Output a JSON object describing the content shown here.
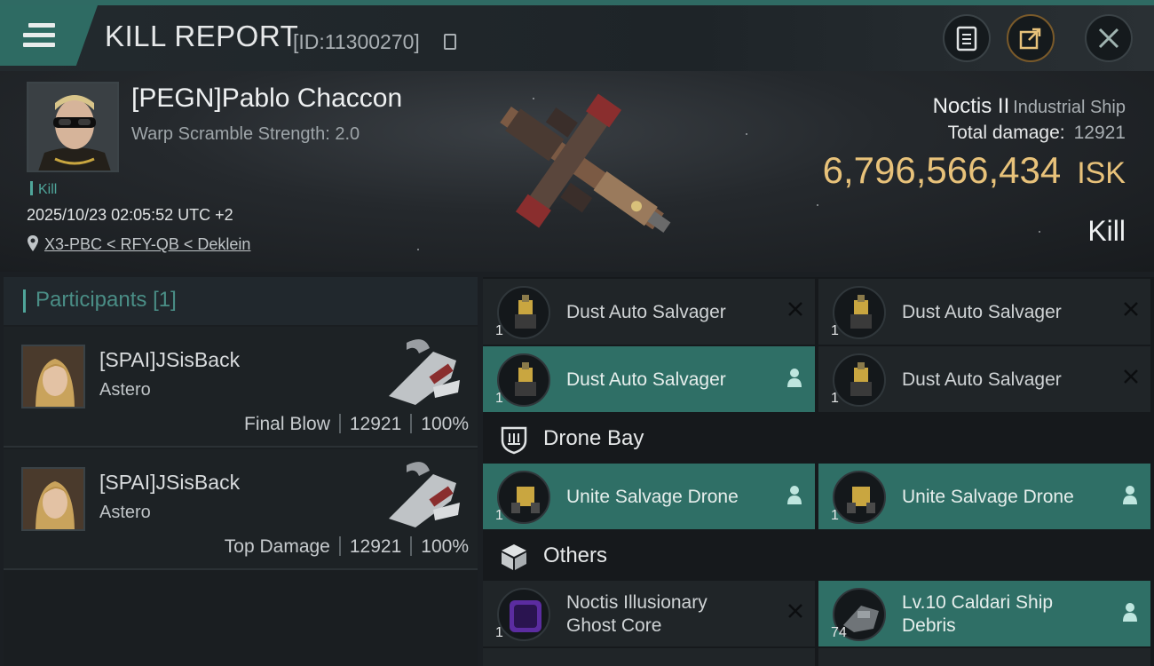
{
  "header": {
    "title": "KILL REPORT",
    "report_id": "[ID:11300270]"
  },
  "victim": {
    "name": "[PEGN]Pablo Chaccon",
    "warp_scramble": "Warp Scramble Strength: 2.0",
    "tag": "Kill",
    "datetime": "2025/10/23 02:05:52 UTC +2",
    "location": "X3-PBC < RFY-QB < Deklein",
    "ship_name": "Noctis II",
    "ship_class": "Industrial Ship",
    "total_damage_label": "Total damage:",
    "total_damage": "12921",
    "isk_value": "6,796,566,434",
    "isk_unit": "ISK",
    "result": "Kill"
  },
  "participants": {
    "title": "Participants",
    "count": "[1]",
    "rows": [
      {
        "name": "[SPAI]JSisBack",
        "ship": "Astero",
        "label": "Final Blow",
        "damage": "12921",
        "percent": "100%"
      },
      {
        "name": "[SPAI]JSisBack",
        "ship": "Astero",
        "label": "Top Damage",
        "damage": "12921",
        "percent": "100%"
      }
    ]
  },
  "items": {
    "fitted": [
      {
        "name": "Dust Auto Salvager",
        "qty": "1",
        "status": "destroyed"
      },
      {
        "name": "Dust Auto Salvager",
        "qty": "1",
        "status": "destroyed"
      },
      {
        "name": "Dust Auto Salvager",
        "qty": "1",
        "status": "dropped"
      },
      {
        "name": "Dust Auto Salvager",
        "qty": "1",
        "status": "destroyed"
      }
    ],
    "drone_bay_title": "Drone Bay",
    "drones": [
      {
        "name": "Unite Salvage Drone",
        "qty": "1",
        "status": "dropped"
      },
      {
        "name": "Unite Salvage Drone",
        "qty": "1",
        "status": "dropped"
      }
    ],
    "others_title": "Others",
    "others": [
      {
        "name_line1": "Noctis Illusionary",
        "name_line2": "Ghost Core",
        "qty": "1",
        "status": "destroyed"
      },
      {
        "name_line1": "Lv.10 Caldari Ship",
        "name_line2": "Debris",
        "qty": "74",
        "status": "dropped"
      }
    ]
  },
  "colors": {
    "accent": "#2f6f66",
    "isk": "#e8c27a"
  }
}
